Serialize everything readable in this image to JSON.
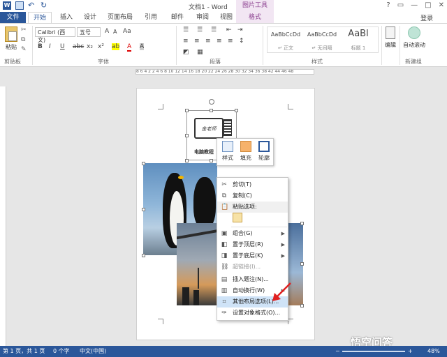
{
  "title": {
    "doc_title": "文档1 - Word",
    "picture_tools": "图片工具",
    "controls": {
      "help": "?",
      "restore": "▭",
      "minimize": "—",
      "maximize": "□",
      "close": "✕"
    }
  },
  "tabs": {
    "file": "文件",
    "home": "开始",
    "insert": "插入",
    "design": "设计",
    "layout": "页面布局",
    "references": "引用",
    "mailings": "邮件",
    "review": "审阅",
    "view": "视图",
    "format": "格式",
    "login": "登录"
  },
  "ribbon": {
    "paste": "粘贴",
    "clipboard_group": "剪贴板",
    "font_name": "Calibri (西文)",
    "font_size": "五号",
    "font_group": "字体",
    "font_buttons": {
      "grow": "A",
      "shrink": "A",
      "clear": "Aa",
      "bold": "B",
      "italic": "I",
      "underline": "U",
      "strike": "abc",
      "subscript": "x₂",
      "superscript": "x²",
      "highlight": "ab",
      "color": "A",
      "char_shade": "A"
    },
    "paragraph_group": "段落",
    "styles": [
      {
        "sample": "AaBbCcDd",
        "name": "↵ 正文"
      },
      {
        "sample": "AaBbCcDd",
        "name": "↵ 无间隔"
      },
      {
        "sample": "AaBl",
        "name": "标题 1"
      }
    ],
    "styles_group": "样式",
    "edit": "编辑",
    "auto_scroll": "自动滚动",
    "new_group": "新建组"
  },
  "ruler": {
    "text": "8  6  4  2        2  4  6  8  10  12  14  16  18  20  22  24  26  28  30  32  34  36  38  42  44  46  48"
  },
  "computer_image": {
    "screen_text": "金老师",
    "label": "电脑教程"
  },
  "minibar": {
    "style": "样式",
    "fill": "填充",
    "outline": "轮廓"
  },
  "context_menu": {
    "cut": "剪切(T)",
    "copy": "复制(C)",
    "paste_options": "粘贴选项:",
    "group": "组合(G)",
    "bring_front": "置于顶层(R)",
    "send_back": "置于底层(K)",
    "hyperlink": "超链接(I)...",
    "insert_caption": "插入题注(N)...",
    "wrap_text": "自动换行(W)",
    "more_layout": "其他布局选项(L)...",
    "format_object": "设置对象格式(O)..."
  },
  "status": {
    "page": "第 1 页，共 1 页",
    "words": "0 个字",
    "lang": "中文(中国)",
    "zoom": "48%",
    "zoom_minus": "−",
    "zoom_plus": "+"
  },
  "watermark": "悟空问答",
  "colors": {
    "brand": "#2b579a",
    "picture_tools": "#8b3f8f",
    "arrow": "#e02020"
  }
}
